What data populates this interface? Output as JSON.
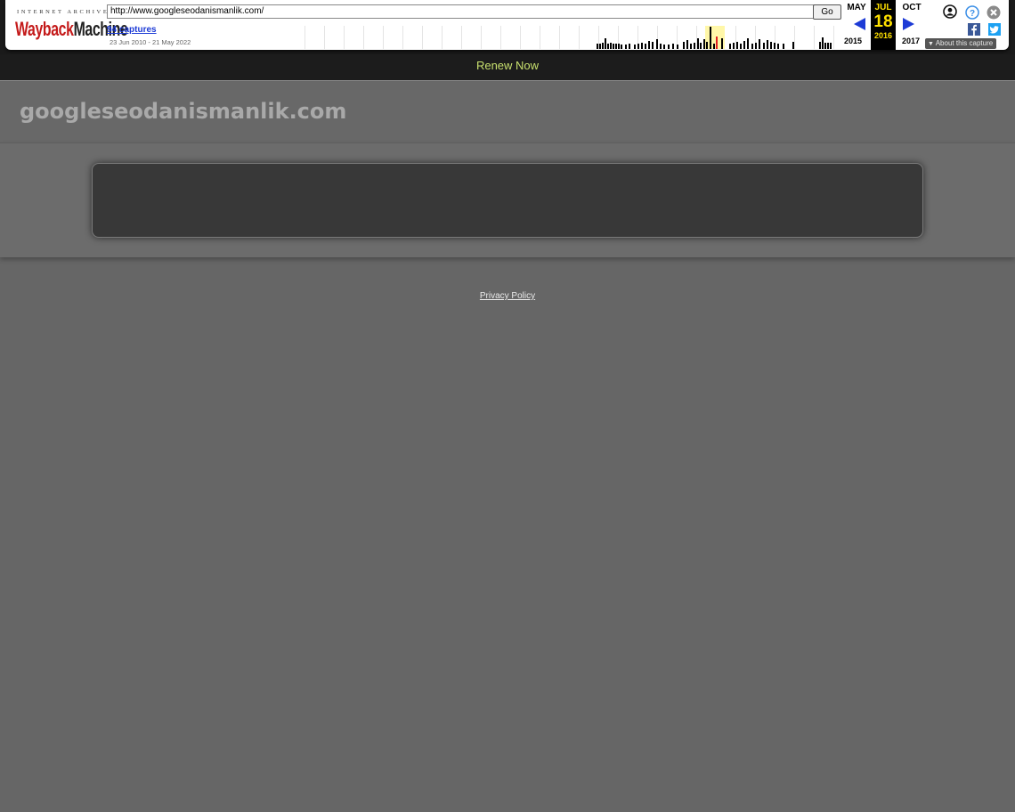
{
  "wayback": {
    "logo_top": "INTERNET ARCHIVE",
    "logo_wayback": "Wayback",
    "logo_machine": "Machine",
    "url": "http://www.googleseodanismanlik.com/",
    "go_label": "Go",
    "captures_label": "94 captures",
    "date_range": "23 Jun 2010 - 21 May 2022",
    "prev_month": "MAY",
    "prev_year": "2015",
    "current_month": "JUL",
    "current_day": "18",
    "current_year": "2016",
    "next_month": "OCT",
    "next_year": "2017",
    "about_label": "About this capture",
    "icons": [
      "user-icon",
      "help-icon",
      "close-icon",
      "facebook-icon",
      "twitter-icon"
    ],
    "accent_color": "#ffe100",
    "link_color": "#1d3bd6"
  },
  "renew": {
    "label": "Renew Now",
    "color": "#c8e06e"
  },
  "site": {
    "title": "googleseodanismanlik.com",
    "privacy_label": "Privacy Policy"
  }
}
